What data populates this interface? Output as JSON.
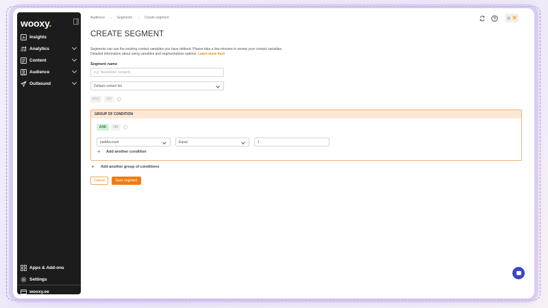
{
  "app": {
    "logo_text": "wooxy",
    "logo_dot": "."
  },
  "sidebar": {
    "items": [
      {
        "label": "Insights",
        "icon": "chart-box-icon",
        "has_chevron": false
      },
      {
        "label": "Analytics",
        "icon": "analytics-icon",
        "has_chevron": true
      },
      {
        "label": "Content",
        "icon": "content-icon",
        "has_chevron": true
      },
      {
        "label": "Audience",
        "icon": "audience-icon",
        "has_chevron": true
      },
      {
        "label": "Outbound",
        "icon": "paper-plane-icon",
        "has_chevron": true
      }
    ],
    "bottom_items": [
      {
        "label": "Apps & Add-ons",
        "icon": "apps-grid-icon"
      },
      {
        "label": "Settings",
        "icon": "gear-icon"
      }
    ],
    "account": {
      "label": "wooxy.ee",
      "icon": "account-card-icon"
    }
  },
  "header": {
    "breadcrumb": [
      "Audience",
      "→",
      "Segments",
      "→",
      "Create segment"
    ],
    "icons": [
      "sync-icon",
      "help-icon"
    ]
  },
  "page": {
    "title": "CREATE SEGMENT",
    "description_line1": "Segments can use the existing contact variables you have defined. Please take a few minutes to review your contact variables.",
    "description_line2": "Detailed information about using variables and segmentations options.",
    "learn_more": "Learn more here",
    "segment_name_label": "Segment name",
    "segment_name_placeholder": "e.g. Newsletter contacts",
    "contact_list_value": "Default contact list",
    "top_and": "AND",
    "top_or": "OR"
  },
  "group": {
    "header": "GROUP OF CONDITION",
    "and_label": "AND",
    "or_label": "OR",
    "condition": {
      "field": "paidAccount",
      "operator": "Equal",
      "value": "1"
    },
    "add_condition": "Add another condition"
  },
  "add_group": "Add another group of conditions",
  "actions": {
    "cancel": "Cancel",
    "save": "Save segment"
  },
  "colors": {
    "accent": "#f07c14",
    "group_border": "#f0b278",
    "group_header": "#fbe7d5",
    "chat": "#3b46c9"
  }
}
